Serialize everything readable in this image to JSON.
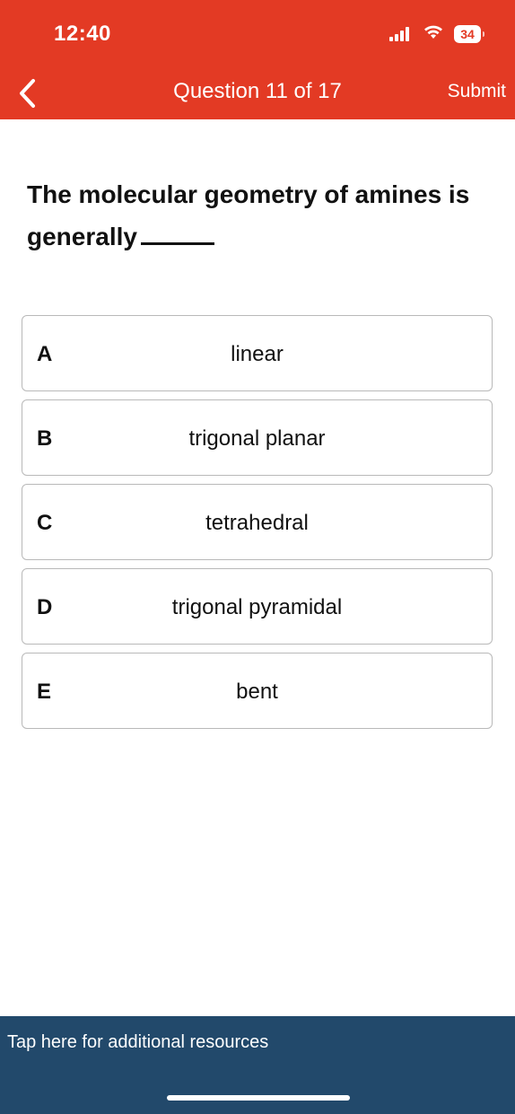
{
  "status_bar": {
    "time": "12:40",
    "battery": "34",
    "signal_icon": "cellular-signal-icon",
    "wifi_icon": "wifi-icon"
  },
  "nav": {
    "back_icon": "chevron-left-icon",
    "title": "Question 11 of 17",
    "submit_label": "Submit"
  },
  "question": {
    "text": "The molecular geometry of amines is generally"
  },
  "answers": [
    {
      "letter": "A",
      "text": "linear"
    },
    {
      "letter": "B",
      "text": "trigonal planar"
    },
    {
      "letter": "C",
      "text": "tetrahedral"
    },
    {
      "letter": "D",
      "text": "trigonal pyramidal"
    },
    {
      "letter": "E",
      "text": "bent"
    }
  ],
  "footer": {
    "resources_label": "Tap here for additional resources"
  },
  "colors": {
    "header": "#e33a24",
    "footer": "#22496b",
    "border": "#b9b9b9"
  }
}
